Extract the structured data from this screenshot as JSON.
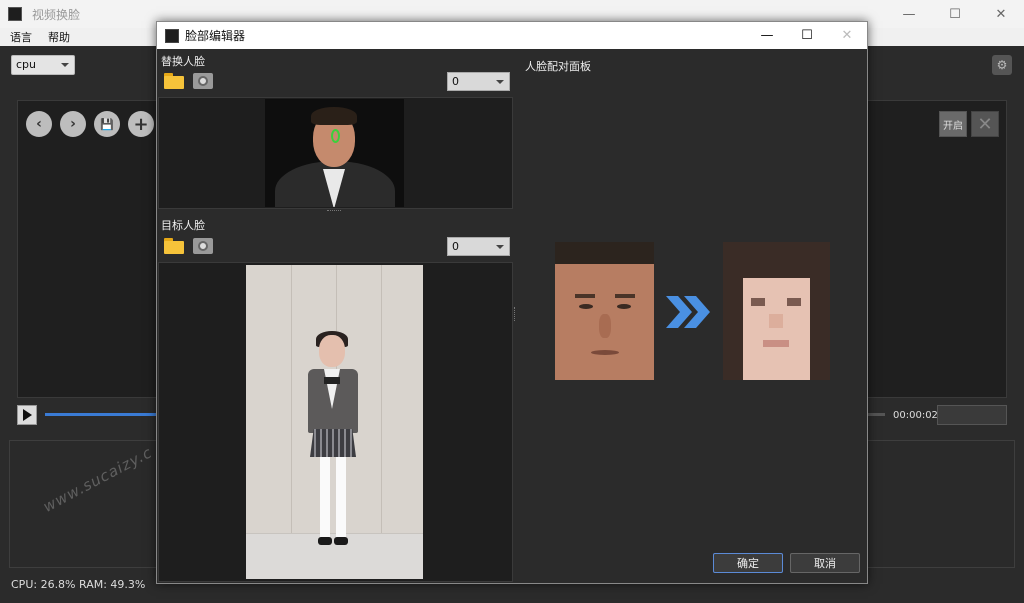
{
  "main_window": {
    "title": "视频换脸",
    "controls": {
      "minimize": "—",
      "maximize": "☐",
      "close": "✕"
    },
    "menu": [
      "语言",
      "帮助"
    ],
    "device": "cpu",
    "toolbar": {
      "prev": "‹",
      "next": "›",
      "save": "💾",
      "add": "+"
    },
    "open_label": "开启",
    "close_x": "✕",
    "time": "00:00:02",
    "playback_progress": 0.137,
    "status": "CPU: 26.8%  RAM: 49.3%",
    "watermark": "www.sucaizy.c"
  },
  "dialog": {
    "title": "脸部编辑器",
    "controls": {
      "minimize": "—",
      "maximize": "☐",
      "close": "✕"
    },
    "source_section": {
      "label": "替换人脸",
      "index": "0"
    },
    "target_section": {
      "label": "目标人脸",
      "index": "0"
    },
    "pairing_label": "人脸配对面板",
    "ok": "确定",
    "cancel": "取消"
  },
  "colors": {
    "accent": "#3a7bd5",
    "arrow": "#4a90e2",
    "background": "#2b2b2b"
  }
}
